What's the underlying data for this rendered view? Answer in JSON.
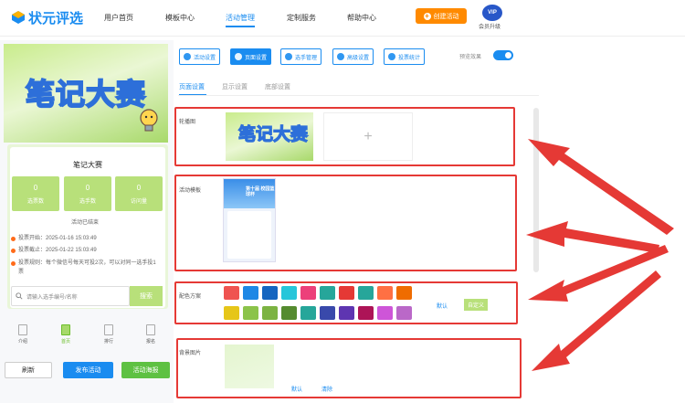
{
  "brand": {
    "name": "状元评选"
  },
  "nav": {
    "items": [
      {
        "label": "用户首页"
      },
      {
        "label": "模板中心"
      },
      {
        "label": "活动管理"
      },
      {
        "label": "定制服务"
      },
      {
        "label": "帮助中心"
      }
    ],
    "active_index": 2,
    "create_button": "创建活动",
    "vip_badge": "VIP",
    "vip_label": "会员升级"
  },
  "preview": {
    "banner_title": "笔记大赛",
    "card_title": "笔记大赛",
    "stats": [
      {
        "value": "0",
        "label": "选票数"
      },
      {
        "value": "0",
        "label": "选手数"
      },
      {
        "value": "0",
        "label": "访问量"
      }
    ],
    "status": "活动已结束",
    "info": [
      {
        "text": "投票开始：2025-01-16 15:03:49"
      },
      {
        "text": "投票截止：2025-01-22 15:03:49"
      },
      {
        "text": "投票规则：每个微信号每天可投2次，可以对同一选手投1票"
      }
    ],
    "search_placeholder": "请输入选手编号/名称",
    "search_button": "搜索",
    "tabbar": [
      {
        "label": "介绍"
      },
      {
        "label": "首页"
      },
      {
        "label": "排行"
      },
      {
        "label": "报名"
      }
    ],
    "tabbar_active_index": 1,
    "buttons": {
      "refresh": "刷新",
      "publish": "发布活动",
      "poster": "活动海报"
    }
  },
  "toolbar": {
    "buttons": [
      {
        "label": "活动设置",
        "icon": "gear-icon"
      },
      {
        "label": "页面设置",
        "icon": "gear-icon"
      },
      {
        "label": "选手管理",
        "icon": "users-icon"
      },
      {
        "label": "高级设置",
        "icon": "sliders-icon"
      },
      {
        "label": "投票统计",
        "icon": "chart-icon"
      }
    ],
    "active_index": 1,
    "preview_label": "预览效果",
    "preview_on": true
  },
  "subtabs": {
    "items": [
      {
        "label": "页面设置"
      },
      {
        "label": "显示设置"
      },
      {
        "label": "底部设置"
      }
    ],
    "active_index": 0
  },
  "sections": {
    "carousel": {
      "label": "轮播图",
      "image_title": "笔记大赛",
      "add_symbol": "+"
    },
    "template": {
      "label": "活动模板",
      "preview_title": "第十届 校园篮球杯"
    },
    "colors": {
      "label": "配色方案",
      "row1": [
        "#ef5350",
        "#1e88e5",
        "#1565c0",
        "#26c6da",
        "#ec407a",
        "#26a69a",
        "#e53935",
        "#26a69a",
        "#ff7043",
        "#ef6c00"
      ],
      "row2": [
        "#e6c619",
        "#8bc34a",
        "#7cb342",
        "#558b2f",
        "#26a69a",
        "#3949ab",
        "#5e35b1",
        "#ad1457",
        "#ce55d8",
        "#ba68c8"
      ],
      "default_label": "默认",
      "custom_label": "自定义"
    },
    "background": {
      "label": "背景图片",
      "default_label": "默认",
      "clear_label": "清除"
    }
  },
  "colors": {
    "accent": "#1a8cf0",
    "orange": "#ff8a00",
    "green": "#5ec142",
    "lime": "#b8e07a",
    "annotation_red": "#e53935"
  }
}
